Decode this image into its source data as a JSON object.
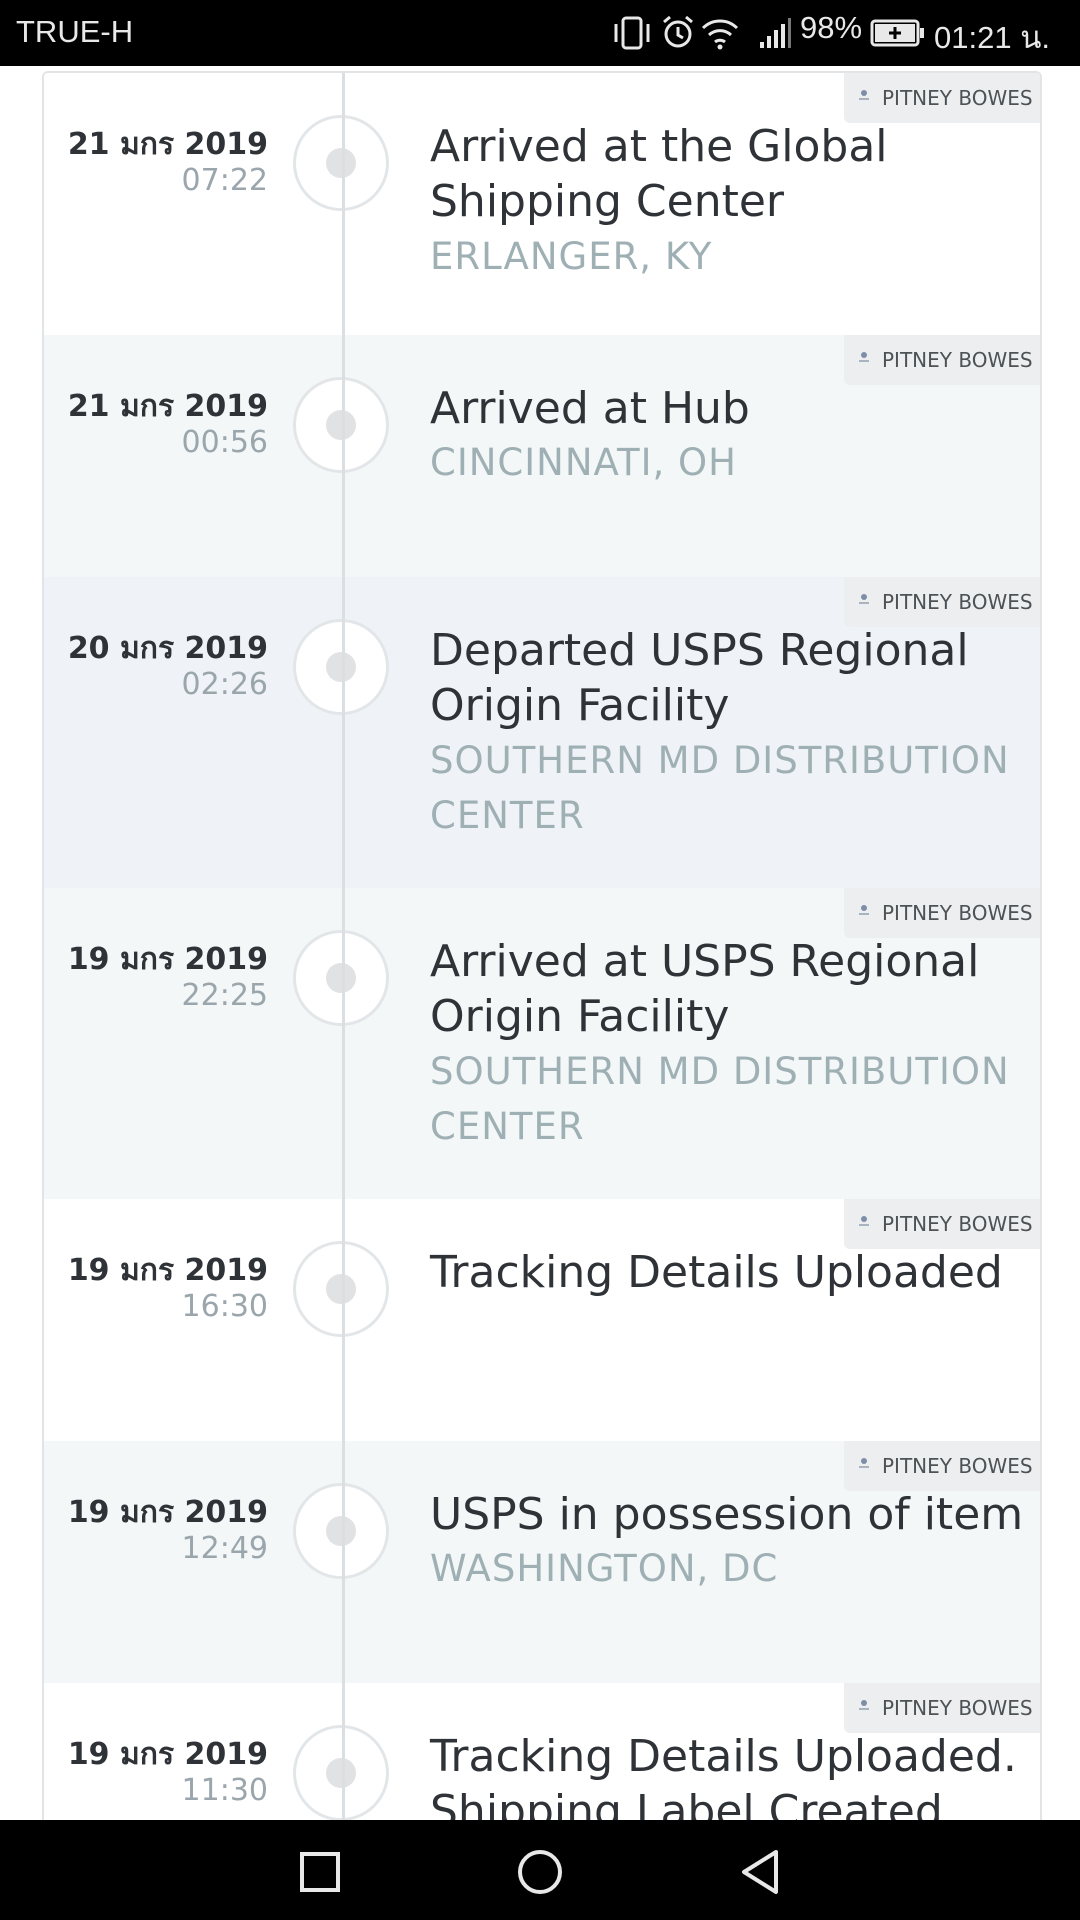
{
  "status_bar": {
    "carrier": "TRUE-H",
    "battery": "98%",
    "time": "01:21 น.",
    "icons": [
      "vibrate-icon",
      "alarm-icon",
      "wifi-icon",
      "signal-icon",
      "battery-icon"
    ]
  },
  "timeline": {
    "entries": [
      {
        "date": "21 มกร 2019",
        "time": "07:22",
        "title": "Arrived at the Global Shipping Center",
        "location": "ERLANGER, KY",
        "carrier": "PITNEY BOWES"
      },
      {
        "date": "21 มกร 2019",
        "time": "00:56",
        "title": "Arrived at Hub",
        "location": "CINCINNATI, OH",
        "carrier": "PITNEY BOWES"
      },
      {
        "date": "20 มกร 2019",
        "time": "02:26",
        "title": "Departed USPS Regional Origin Facility",
        "location": "SOUTHERN MD DISTRIBUTION CENTER",
        "carrier": "PITNEY BOWES"
      },
      {
        "date": "19 มกร 2019",
        "time": "22:25",
        "title": "Arrived at USPS Regional Origin Facility",
        "location": "SOUTHERN MD DISTRIBUTION CENTER",
        "carrier": "PITNEY BOWES"
      },
      {
        "date": "19 มกร 2019",
        "time": "16:30",
        "title": "Tracking Details Uploaded",
        "location": "",
        "carrier": "PITNEY BOWES"
      },
      {
        "date": "19 มกร 2019",
        "time": "12:49",
        "title": "USPS in possession of item",
        "location": "WASHINGTON, DC",
        "carrier": "PITNEY BOWES"
      },
      {
        "date": "19 มกร 2019",
        "time": "11:30",
        "title": "Tracking Details Uploaded. Shipping Label Created.",
        "location": "",
        "carrier": "PITNEY BOWES"
      }
    ]
  },
  "nav_bar": {
    "buttons": [
      "recent-apps-button",
      "home-button",
      "back-button"
    ]
  }
}
